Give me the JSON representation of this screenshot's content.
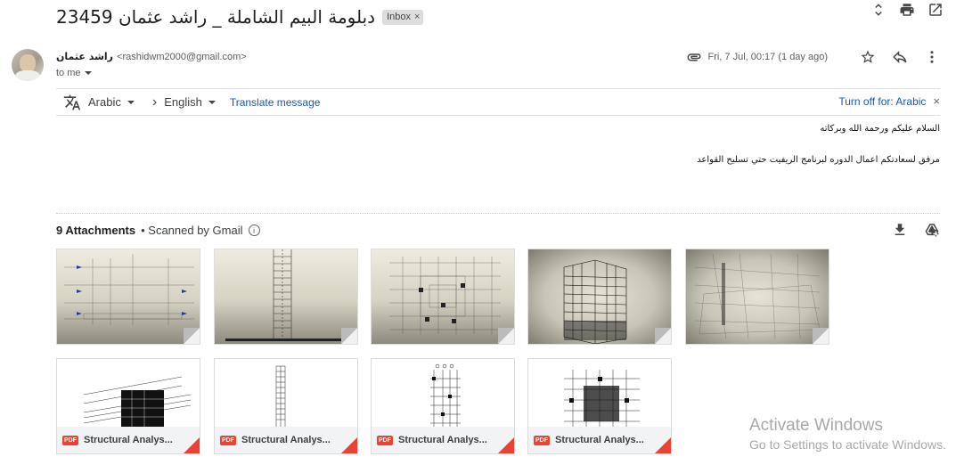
{
  "subject": {
    "title": "دبلومة البيم الشاملة _ راشد عثمان 23459",
    "badge": "Inbox",
    "badge_close": "×"
  },
  "sender": {
    "name": "راشد عثمان",
    "email": "<rashidwm2000@gmail.com>",
    "to": "to me"
  },
  "meta": {
    "date": "Fri, 7 Jul, 00:17 (1 day ago)"
  },
  "translate": {
    "from_lang": "Arabic",
    "to_lang": "English",
    "translate_link": "Translate message",
    "turn_off": "Turn off for: Arabic",
    "close": "×"
  },
  "body": {
    "line1": "السلام عليكم ورحمة الله وبركاته",
    "line2": "مرفق لسعادتكم اعمال الدوره لبرنامج الريفيت حتي تسليح القواعد"
  },
  "attachments": {
    "count_label": "9 Attachments",
    "scanned_label": "• Scanned by Gmail",
    "info": "i",
    "pdfs": [
      {
        "name": "Structural Analys...",
        "badge": "PDF"
      },
      {
        "name": "Structural Analys...",
        "badge": "PDF"
      },
      {
        "name": "Structural Analys...",
        "badge": "PDF"
      },
      {
        "name": "Structural Analys...",
        "badge": "PDF"
      }
    ]
  },
  "watermark": {
    "line1": "Activate Windows",
    "line2": "Go to Settings to activate Windows."
  },
  "colors": {
    "link": "#1a57b5",
    "pdf_red": "#ea4335",
    "divider": "#e0e0e0"
  }
}
